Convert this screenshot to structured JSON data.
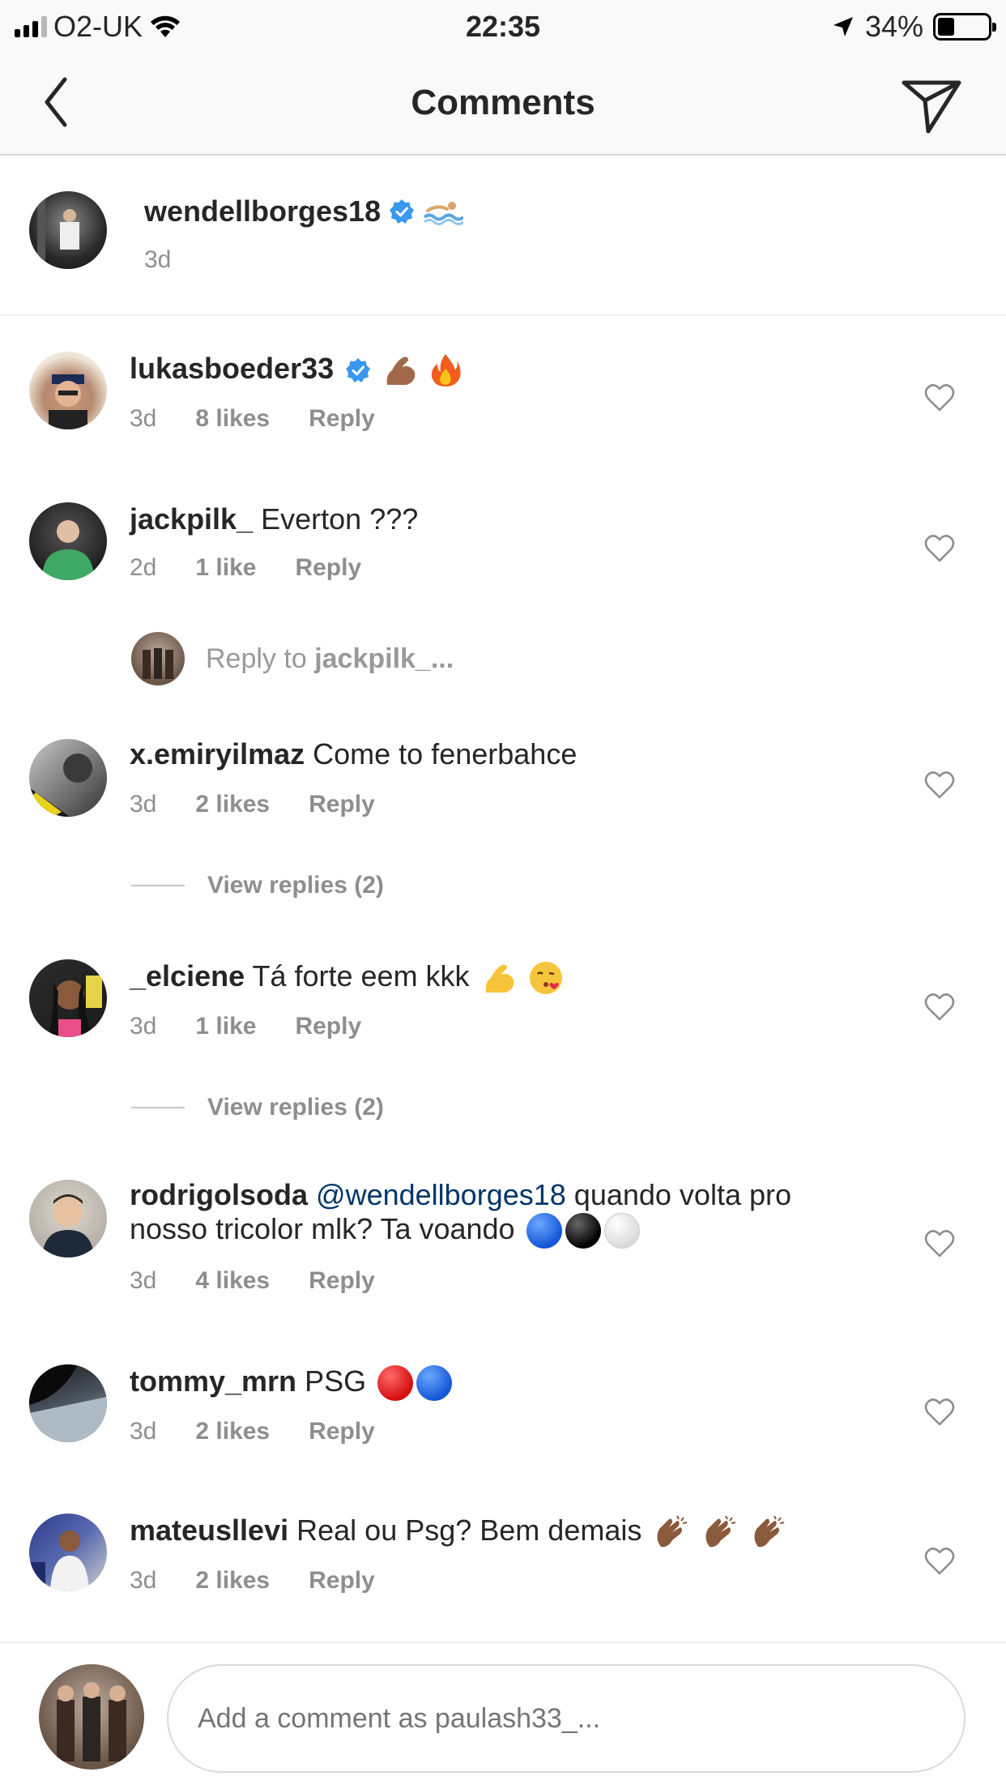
{
  "status_bar": {
    "carrier": "O2-UK",
    "time": "22:35",
    "battery": "34%",
    "battery_level": 0.34,
    "signal_bars": 3
  },
  "header": {
    "title": "Comments",
    "back_icon": "chevron-left-icon",
    "send_icon": "paper-plane-icon"
  },
  "caption": {
    "username": "wendellborges18",
    "time": "3d",
    "emoji": "swimmer-icon"
  },
  "comments": [
    {
      "username": "lukasboeder33",
      "text": "",
      "time": "3d",
      "likes": "8 likes",
      "reply": "Reply"
    },
    {
      "username": "jackpilk_",
      "text": "Everton ???",
      "time": "2d",
      "likes": "1 like",
      "reply": "Reply"
    },
    {
      "username": "x.emiryilmaz",
      "text": "Come to fenerbahce",
      "time": "3d",
      "likes": "2 likes",
      "reply": "Reply"
    },
    {
      "username": "_elciene",
      "text": "Tá forte eem kkk",
      "time": "3d",
      "likes": "1 like",
      "reply": "Reply"
    },
    {
      "username": "rodrigolsoda",
      "mention": "@wendellborges18",
      "text": "quando volta pro nosso tricolor mlk? Ta voando",
      "time": "3d",
      "likes": "4 likes",
      "reply": "Reply"
    },
    {
      "username": "tommy_mrn",
      "text": "PSG",
      "time": "3d",
      "likes": "2 likes",
      "reply": "Reply"
    },
    {
      "username": "mateusllevi",
      "text": "Real ou Psg? Bem demais",
      "time": "3d",
      "likes": "2 likes",
      "reply": "Reply"
    }
  ],
  "reply_prompt": {
    "prefix": "Reply to",
    "username": "jackpilk_..."
  },
  "view_replies": [
    "View replies (2)",
    "View replies (2)"
  ],
  "composer": {
    "placeholder": "Add a comment as paulash33_..."
  },
  "colors": {
    "verified": "#3897f0",
    "mention": "#003569",
    "meta": "#8e8e8e",
    "text": "#262626"
  }
}
